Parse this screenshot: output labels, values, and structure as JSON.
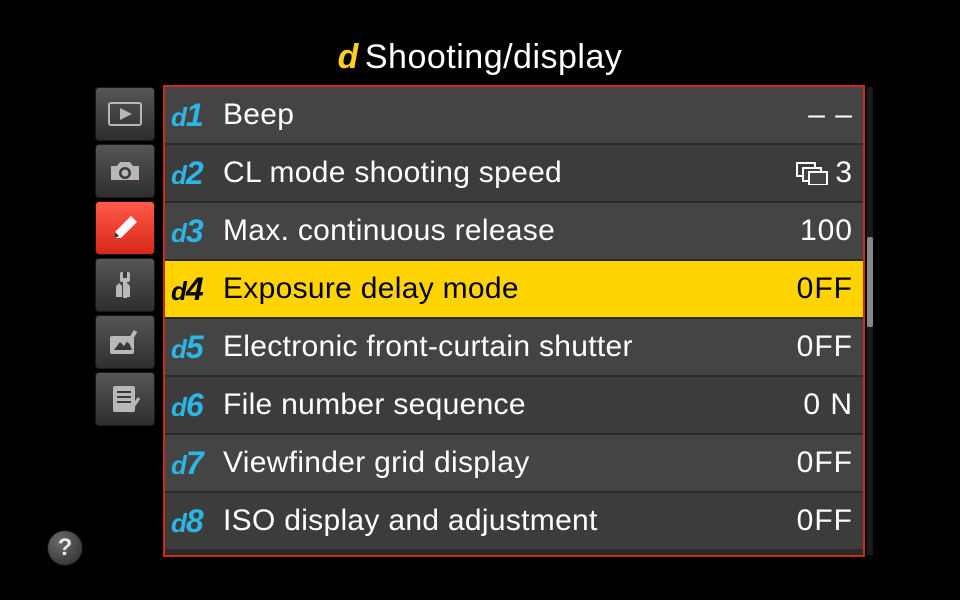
{
  "header": {
    "prefix": "d",
    "title": "Shooting/display"
  },
  "sidebar": {
    "active_index": 2
  },
  "help": {
    "label": "?"
  },
  "menu": {
    "code_letter": "d",
    "items": [
      {
        "num": "1",
        "label": "Beep",
        "value": "– –",
        "icon": null,
        "highlighted": false
      },
      {
        "num": "2",
        "label": "CL mode shooting speed",
        "value": "3",
        "icon": "burst",
        "highlighted": false
      },
      {
        "num": "3",
        "label": "Max. continuous release",
        "value": "100",
        "icon": null,
        "highlighted": false
      },
      {
        "num": "4",
        "label": "Exposure delay mode",
        "value": "0FF",
        "icon": null,
        "highlighted": true
      },
      {
        "num": "5",
        "label": "Electronic front-curtain shutter",
        "value": "0FF",
        "icon": null,
        "highlighted": false
      },
      {
        "num": "6",
        "label": "File number sequence",
        "value": "0 N",
        "icon": null,
        "highlighted": false
      },
      {
        "num": "7",
        "label": "Viewfinder grid display",
        "value": "0FF",
        "icon": null,
        "highlighted": false
      },
      {
        "num": "8",
        "label": "ISO display and adjustment",
        "value": "0FF",
        "icon": null,
        "highlighted": false
      }
    ]
  }
}
